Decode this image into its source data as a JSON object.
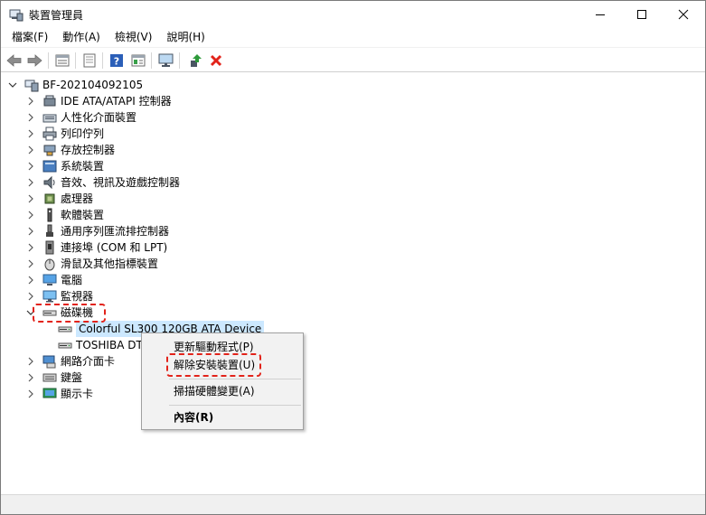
{
  "window": {
    "title": "裝置管理員",
    "controls": {
      "minimize_icon": "minimize-icon",
      "maximize_icon": "maximize-icon",
      "close_icon": "close-icon"
    }
  },
  "menu": {
    "items": [
      "檔案(F)",
      "動作(A)",
      "檢視(V)",
      "說明(H)"
    ]
  },
  "toolbar": {
    "icons": [
      "back-arrow-icon",
      "forward-arrow-icon",
      "properties-icon",
      "show-hidden-icon",
      "help-icon",
      "action-view-icon",
      "computer-monitor-icon",
      "update-driver-icon",
      "uninstall-icon"
    ],
    "uninstall_color": "#e2231a",
    "help_color": "#2b5fb8"
  },
  "tree": {
    "root": "BF-202104092105",
    "categories": [
      "IDE ATA/ATAPI 控制器",
      "人性化介面裝置",
      "列印佇列",
      "存放控制器",
      "系統裝置",
      "音效、視訊及遊戲控制器",
      "處理器",
      "軟體裝置",
      "通用序列匯流排控制器",
      "連接埠 (COM 和 LPT)",
      "滑鼠及其他指標裝置",
      "電腦",
      "監視器",
      "磁碟機",
      "網路介面卡",
      "鍵盤",
      "顯示卡"
    ],
    "expanded_category": "磁碟機",
    "disk_devices": [
      "Colorful SL300 120GB ATA Device",
      "TOSHIBA DT"
    ],
    "selected_device": "Colorful SL300 120GB ATA Device",
    "selection_color": "#cce8ff"
  },
  "context_menu": {
    "items": [
      "更新驅動程式(P)",
      "解除安裝裝置(U)",
      "掃描硬體變更(A)",
      "內容(R)"
    ],
    "highlight_color": "#e2231a"
  }
}
